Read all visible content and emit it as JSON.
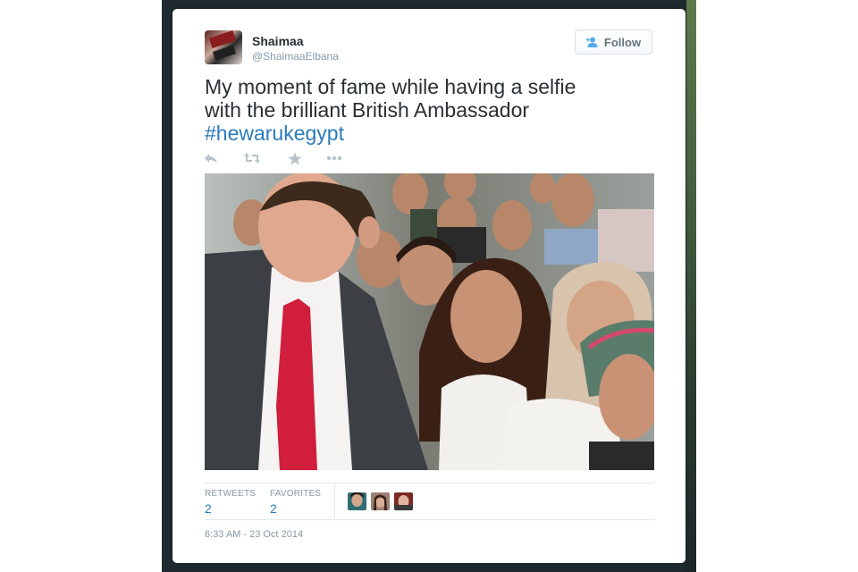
{
  "tweet": {
    "author_name": "Shaimaa",
    "author_handle": "@ShaimaaElbana",
    "follow_label": "Follow",
    "text_line1": "My moment of fame while having a selfie",
    "text_line2": "with the brilliant British Ambassador",
    "hashtag": "#hewarukegypt",
    "actions": [
      "reply-icon",
      "retweet-icon",
      "favorite-icon",
      "more-icon"
    ],
    "retweets_label": "RETWEETS",
    "retweets_count": "2",
    "favorites_label": "FAVORITES",
    "favorites_count": "2",
    "timestamp": "6:33 AM - 23 Oct 2014"
  },
  "colors": {
    "link": "#2b7bb9",
    "text": "#292f33",
    "muted": "#8899a6",
    "backdrop": "#1e2a30"
  }
}
